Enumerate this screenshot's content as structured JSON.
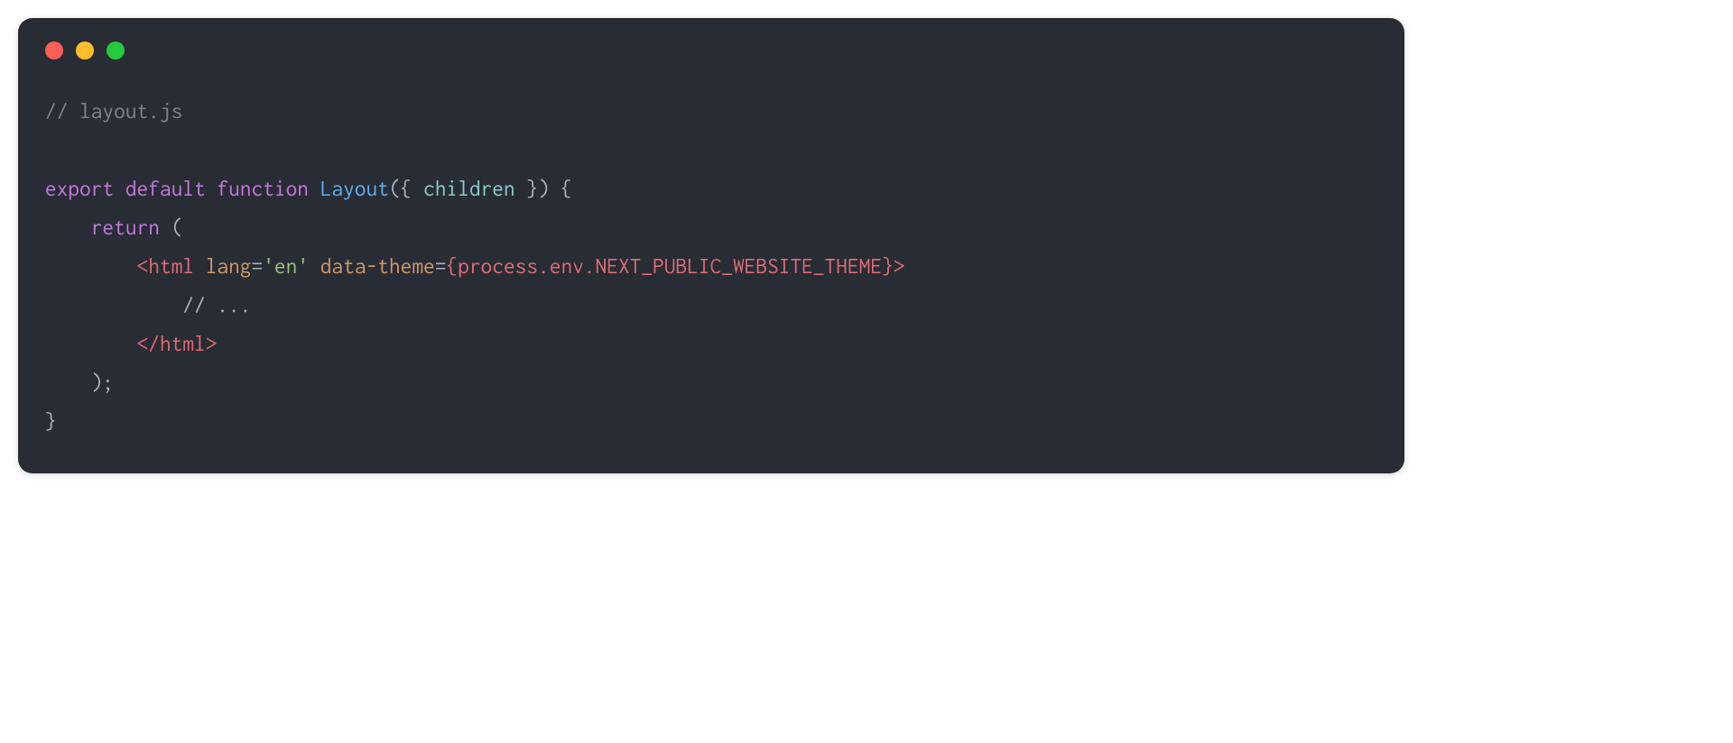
{
  "window": {
    "traffic_lights": [
      "red",
      "yellow",
      "green"
    ]
  },
  "code": {
    "line1_comment": "// layout.js",
    "line3_export": "export",
    "line3_default": "default",
    "line3_function": "function",
    "line3_name": "Layout",
    "line3_open_paren": "(",
    "line3_destruct_open": "{ ",
    "line3_param": "children",
    "line3_destruct_close": " }",
    "line3_close_paren": ")",
    "line3_space_brace": " {",
    "line4_indent": "    ",
    "line4_return": "return",
    "line4_open": " (",
    "line5_indent": "        ",
    "line5_tag_open": "<",
    "line5_tag_name": "html",
    "line5_attr1_name": "lang",
    "line5_eq1": "=",
    "line5_attr1_val": "'en'",
    "line5_attr2_name": "data-theme",
    "line5_eq2": "=",
    "line5_jsx_open": "{",
    "line5_jsx_expr": "process.env.NEXT_PUBLIC_WEBSITE_THEME",
    "line5_jsx_close": "}",
    "line5_tag_close": ">",
    "line6_indent": "            ",
    "line6_comment": "// ...",
    "line7_indent": "        ",
    "line7_close_open": "</",
    "line7_close_name": "html",
    "line7_close_end": ">",
    "line8_indent": "    ",
    "line8_close": ");",
    "line9_close": "}"
  }
}
